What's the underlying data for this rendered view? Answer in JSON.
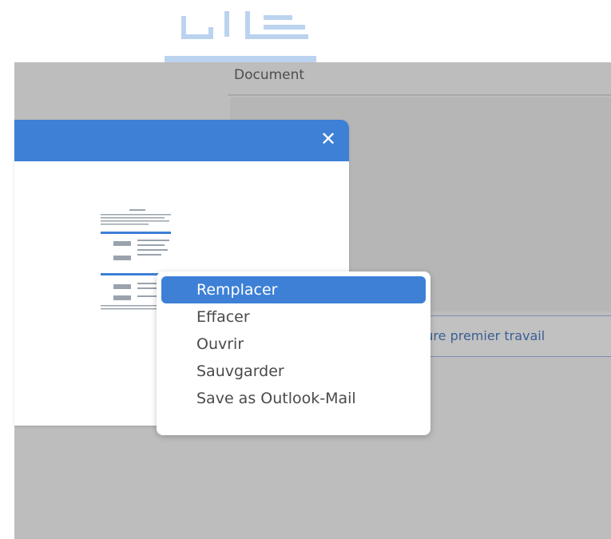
{
  "document": {
    "label": "Document",
    "field_text": "ture premier travail"
  },
  "modal": {
    "close_icon": "close-icon",
    "header_color": "#3d80d6"
  },
  "context_menu": {
    "items": [
      {
        "label": "Remplacer",
        "active": true
      },
      {
        "label": "Effacer",
        "active": false
      },
      {
        "label": "Ouvrir",
        "active": false
      },
      {
        "label": "Sauvgarder",
        "active": false
      },
      {
        "label": "Save as Outlook-Mail",
        "active": false
      }
    ],
    "accent_color": "#3d80d6"
  }
}
